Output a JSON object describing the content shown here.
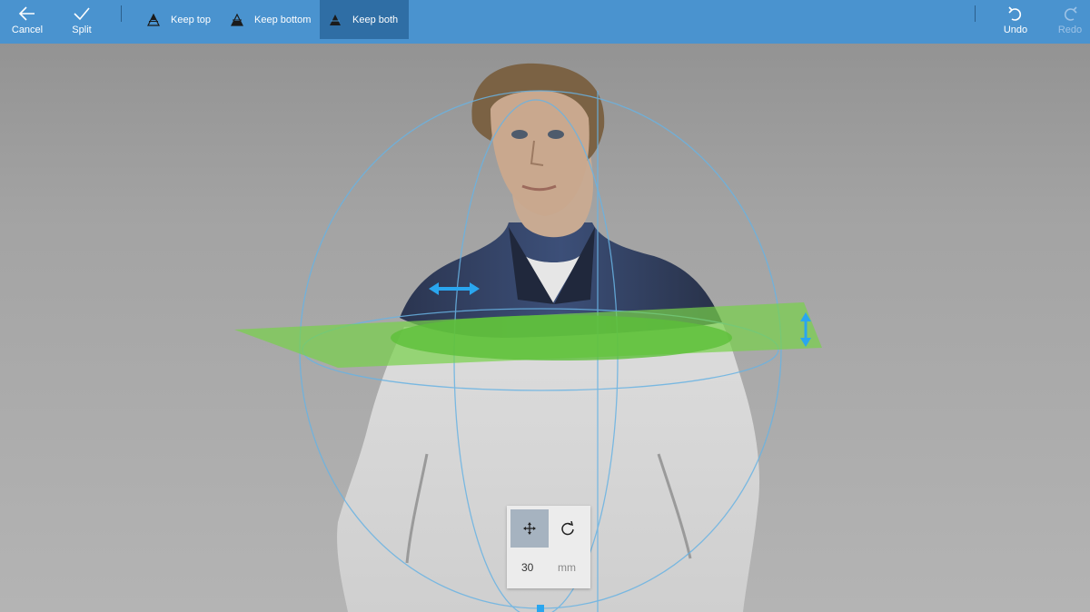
{
  "toolbar": {
    "cancel_label": "Cancel",
    "split_label": "Split",
    "keep_top_label": "Keep top",
    "keep_bottom_label": "Keep bottom",
    "keep_both_label": "Keep both",
    "selected_mode": "Keep both",
    "undo_label": "Undo",
    "redo_label": "Redo",
    "redo_enabled": false
  },
  "transform_panel": {
    "active_tool": "move",
    "tools": [
      "move-icon",
      "rotate-icon"
    ],
    "distance_value": "30",
    "distance_unit": "mm"
  },
  "colors": {
    "toolbar_bg": "#4a93cf",
    "selected_bg": "#2f6ea5",
    "cut_plane": "#78d24a",
    "gizmo_handle": "#2aa6ef"
  }
}
